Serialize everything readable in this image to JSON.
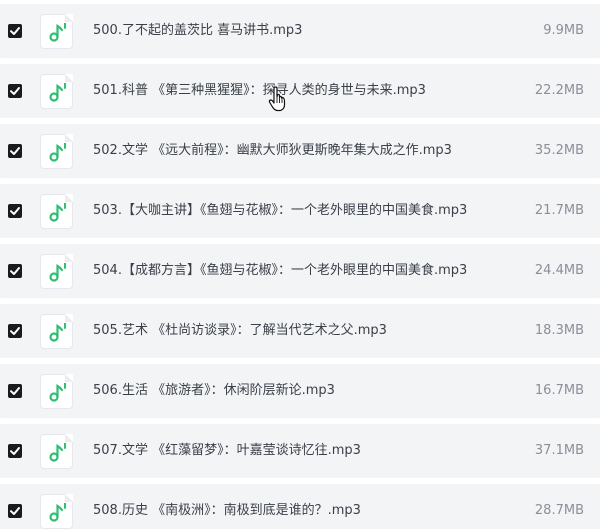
{
  "files": [
    {
      "name": "500.了不起的盖茨比 喜马讲书.mp3",
      "size": "9.9MB",
      "checked": true
    },
    {
      "name": "501.科普 《第三种黑猩猩》：探寻人类的身世与未来.mp3",
      "size": "22.2MB",
      "checked": true
    },
    {
      "name": "502.文学 《远大前程》：幽默大师狄更斯晚年集大成之作.mp3",
      "size": "35.2MB",
      "checked": true
    },
    {
      "name": "503.【大咖主讲】《鱼翅与花椒》：一个老外眼里的中国美食.mp3",
      "size": "21.7MB",
      "checked": true
    },
    {
      "name": "504.【成都方言】《鱼翅与花椒》：一个老外眼里的中国美食.mp3",
      "size": "24.4MB",
      "checked": true
    },
    {
      "name": "505.艺术 《杜尚访谈录》：了解当代艺术之父.mp3",
      "size": "18.3MB",
      "checked": true
    },
    {
      "name": "506.生活 《旅游者》：休闲阶层新论.mp3",
      "size": "16.7MB",
      "checked": true
    },
    {
      "name": "507.文学 《红藻留梦》：叶嘉莹谈诗忆往.mp3",
      "size": "37.1MB",
      "checked": true
    },
    {
      "name": "508.历史 《南极洲》：南极到底是谁的？.mp3",
      "size": "28.7MB",
      "checked": true
    }
  ],
  "icons": {
    "file": "music-note-icon",
    "checkbox": "checkbox-checked-icon",
    "cursor": "hand-pointer-cursor-icon"
  },
  "colors": {
    "accent_green": "#2fbf71",
    "row_bg": "#f3f4f6",
    "checkbox": "#1b1b1b",
    "name_text": "#3a3f48",
    "size_text": "#8a8f98"
  }
}
